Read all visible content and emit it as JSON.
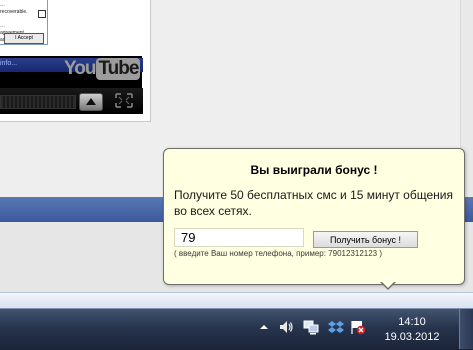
{
  "video": {
    "inner_window_text": "...\nrecoverable.\n\n...\nagreement,\nacceptance.",
    "inner_button_label": "I Accept",
    "info_text": "info...",
    "logo_you": "You",
    "logo_tube": "Tube"
  },
  "popup": {
    "title": "Вы выиграли бонус !",
    "message": "Получите 50 бесплатных смс и 15 минут общения во всех сетях.",
    "phone_value": "79",
    "button_label": "Получить бонус !",
    "hint": "( введите Ваш номер телефона, пример: 79012312123 )"
  },
  "taskbar": {
    "time": "14:10",
    "date": "19.03.2012",
    "tray_icons": [
      "show-hidden-icons",
      "volume-icon",
      "network-icon",
      "dropbox-icon",
      "action-center-icon"
    ]
  },
  "colors": {
    "popup_background": "#ffffe1",
    "page_blue_bar": "#4a67a8",
    "taskbar": "#27344d"
  }
}
